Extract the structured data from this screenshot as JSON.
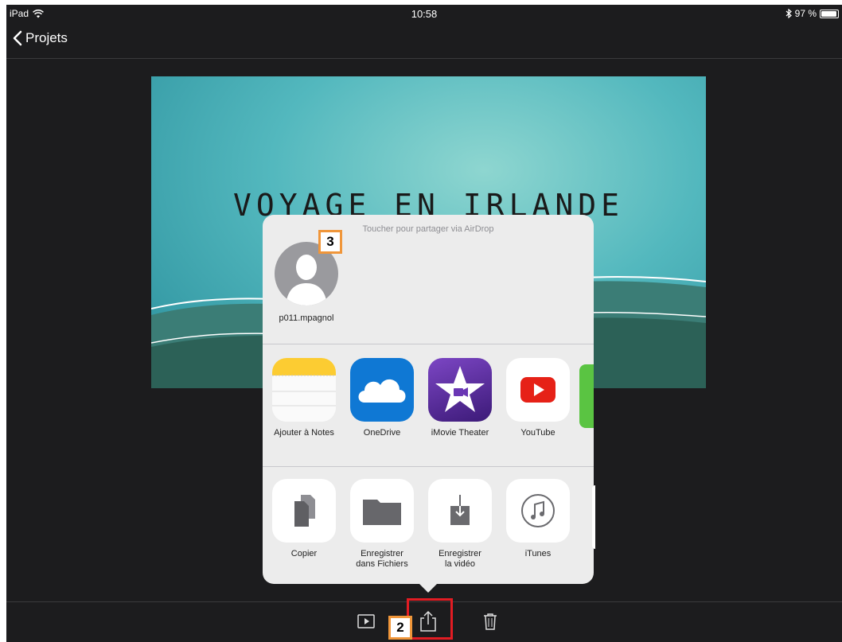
{
  "status_bar": {
    "device": "iPad",
    "time": "10:58",
    "battery": "97 %",
    "battery_level": 0.97
  },
  "nav": {
    "back_label": "Projets"
  },
  "preview": {
    "title": "VOYAGE EN IRLANDE"
  },
  "share_sheet": {
    "airdrop_hint": "Toucher pour partager via AirDrop",
    "contact": {
      "name": "p011.mpagnol"
    },
    "apps": [
      {
        "label": "Ajouter à Notes",
        "icon": "notes-icon"
      },
      {
        "label": "OneDrive",
        "icon": "onedrive-icon"
      },
      {
        "label": "iMovie Theater",
        "icon": "imovie-theater-icon"
      },
      {
        "label": "YouTube",
        "icon": "youtube-icon"
      }
    ],
    "actions": [
      {
        "label": "Copier",
        "icon": "copy-icon"
      },
      {
        "label_line1": "Enregistrer",
        "label_line2": "dans Fichiers",
        "icon": "folder-icon"
      },
      {
        "label_line1": "Enregistrer",
        "label_line2": "la vidéo",
        "icon": "save-video-icon"
      },
      {
        "label": "iTunes",
        "icon": "itunes-icon"
      }
    ]
  },
  "annotations": {
    "marker_2": "2",
    "marker_3": "3",
    "marker_color": "#f0963a",
    "highlight_color": "#e21c23"
  },
  "colors": {
    "background": "#1c1c1e",
    "sheet": "#ececec",
    "youtube_red": "#e62117",
    "imovie_purple": "#5b2a94",
    "onedrive_blue": "#0f78d4",
    "notes_yellow": "#fccc32"
  }
}
